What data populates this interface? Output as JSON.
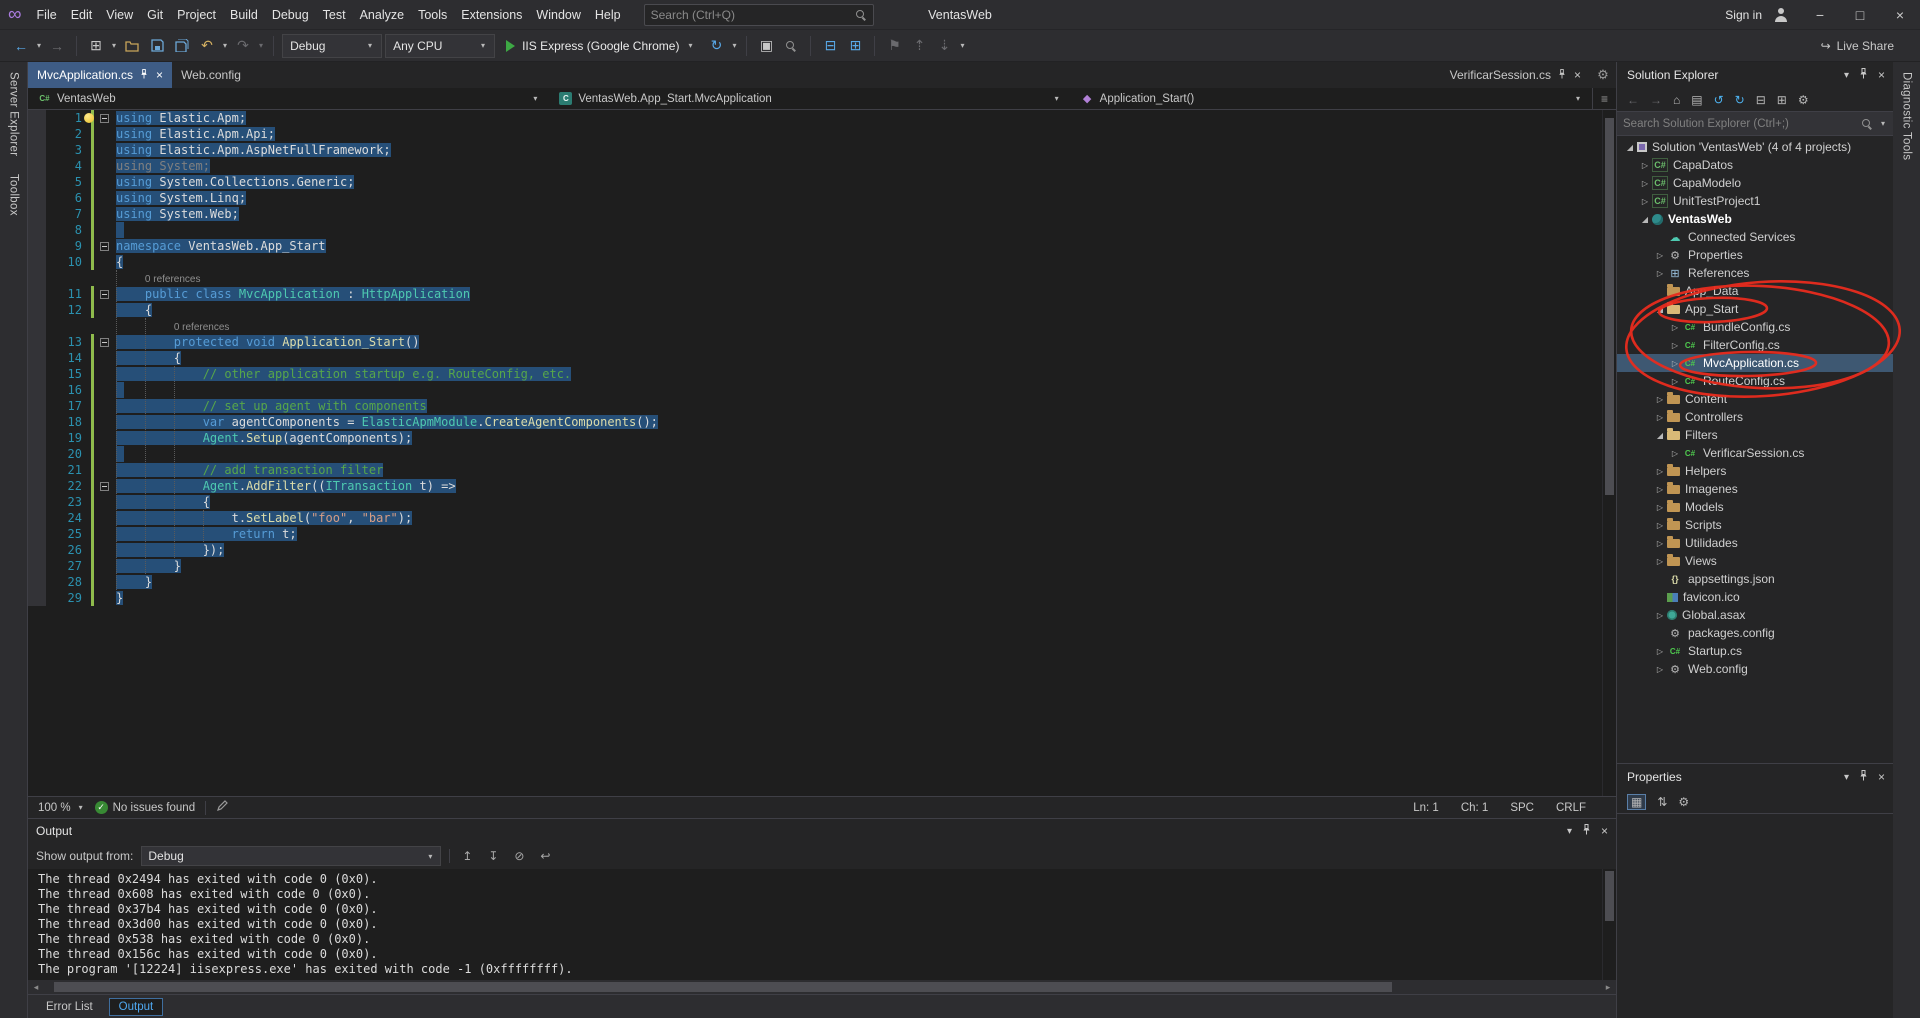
{
  "colors": {
    "accent": "#007ACC",
    "selection": "#264F78",
    "annotation_red": "#E82C1E"
  },
  "title_bar": {
    "menus": [
      "File",
      "Edit",
      "View",
      "Git",
      "Project",
      "Build",
      "Debug",
      "Test",
      "Analyze",
      "Tools",
      "Extensions",
      "Window",
      "Help"
    ],
    "search_placeholder": "Search (Ctrl+Q)",
    "window_title": "VentasWeb",
    "sign_in_label": "Sign in"
  },
  "toolbar": {
    "configuration": "Debug",
    "platform": "Any CPU",
    "run_target": "IIS Express (Google Chrome)",
    "live_share_label": "Live Share"
  },
  "left_strip": {
    "tabs": [
      "Server Explorer",
      "Toolbox"
    ]
  },
  "right_strip": {
    "tabs": [
      "Diagnostic Tools"
    ]
  },
  "document_tabs": {
    "left": [
      {
        "label": "MvcApplication.cs",
        "active": true
      },
      {
        "label": "Web.config",
        "active": false
      }
    ],
    "right": [
      {
        "label": "VerificarSession.cs",
        "active": false
      }
    ]
  },
  "breadcrumb": {
    "segments": [
      {
        "label": "VentasWeb",
        "icon": "csharp-project-icon"
      },
      {
        "label": "VentasWeb.App_Start.MvcApplication",
        "icon": "class-icon"
      },
      {
        "label": "Application_Start()",
        "icon": "method-icon"
      }
    ]
  },
  "editor": {
    "codelens_label": "0 references",
    "lines": [
      {
        "n": 1,
        "fold": true,
        "bulb": true,
        "sel": true,
        "segs": [
          [
            "k",
            "using"
          ],
          [
            "p",
            " Elastic.Apm;"
          ]
        ]
      },
      {
        "n": 2,
        "sel": true,
        "segs": [
          [
            "k",
            "using"
          ],
          [
            "p",
            " Elastic.Apm.Api;"
          ]
        ]
      },
      {
        "n": 3,
        "sel": true,
        "segs": [
          [
            "k",
            "using"
          ],
          [
            "p",
            " Elastic.Apm.AspNetFullFramework;"
          ]
        ]
      },
      {
        "n": 4,
        "sel": true,
        "segs": [
          [
            "d",
            "using System;"
          ]
        ]
      },
      {
        "n": 5,
        "sel": true,
        "segs": [
          [
            "k",
            "using"
          ],
          [
            "p",
            " System.Collections.Generic;"
          ]
        ]
      },
      {
        "n": 6,
        "sel": true,
        "segs": [
          [
            "k",
            "using"
          ],
          [
            "p",
            " System.Linq;"
          ]
        ]
      },
      {
        "n": 7,
        "sel": true,
        "segs": [
          [
            "k",
            "using"
          ],
          [
            "p",
            " System.Web;"
          ]
        ]
      },
      {
        "n": 8,
        "sel": true,
        "segs": []
      },
      {
        "n": 9,
        "fold": true,
        "sel": true,
        "segs": [
          [
            "k",
            "namespace"
          ],
          [
            "p",
            " VentasWeb.App_Start"
          ]
        ]
      },
      {
        "n": 10,
        "sel": true,
        "segs": [
          [
            "p",
            "{"
          ]
        ]
      },
      {
        "lens": true,
        "indent": 4
      },
      {
        "n": 11,
        "fold": true,
        "sel": true,
        "segs": [
          [
            "p",
            "    "
          ],
          [
            "k",
            "public"
          ],
          [
            "p",
            " "
          ],
          [
            "k",
            "class"
          ],
          [
            "p",
            " "
          ],
          [
            "t",
            "MvcApplication"
          ],
          [
            "p",
            " : "
          ],
          [
            "t",
            "HttpApplication"
          ]
        ]
      },
      {
        "n": 12,
        "sel": true,
        "segs": [
          [
            "p",
            "    {"
          ]
        ]
      },
      {
        "lens": true,
        "indent": 8
      },
      {
        "n": 13,
        "fold": true,
        "sel": true,
        "segs": [
          [
            "p",
            "        "
          ],
          [
            "k",
            "protected"
          ],
          [
            "p",
            " "
          ],
          [
            "k",
            "void"
          ],
          [
            "p",
            " "
          ],
          [
            "m",
            "Application_Start"
          ],
          [
            "p",
            "()"
          ]
        ]
      },
      {
        "n": 14,
        "sel": true,
        "segs": [
          [
            "p",
            "        {"
          ]
        ]
      },
      {
        "n": 15,
        "sel": true,
        "segs": [
          [
            "p",
            "            "
          ],
          [
            "c",
            "// other application startup e.g. RouteConfig, etc."
          ]
        ]
      },
      {
        "n": 16,
        "sel": true,
        "segs": []
      },
      {
        "n": 17,
        "sel": true,
        "segs": [
          [
            "p",
            "            "
          ],
          [
            "c",
            "// set up agent with components"
          ]
        ]
      },
      {
        "n": 18,
        "sel": true,
        "segs": [
          [
            "p",
            "            "
          ],
          [
            "k",
            "var"
          ],
          [
            "p",
            " agentComponents = "
          ],
          [
            "t",
            "ElasticApmModule"
          ],
          [
            "p",
            "."
          ],
          [
            "m",
            "CreateAgentComponents"
          ],
          [
            "p",
            "();"
          ]
        ]
      },
      {
        "n": 19,
        "sel": true,
        "segs": [
          [
            "p",
            "            "
          ],
          [
            "t",
            "Agent"
          ],
          [
            "p",
            "."
          ],
          [
            "m",
            "Setup"
          ],
          [
            "p",
            "(agentComponents);"
          ]
        ]
      },
      {
        "n": 20,
        "sel": true,
        "segs": []
      },
      {
        "n": 21,
        "sel": true,
        "segs": [
          [
            "p",
            "            "
          ],
          [
            "c",
            "// add transaction filter"
          ]
        ]
      },
      {
        "n": 22,
        "fold": true,
        "sel": true,
        "segs": [
          [
            "p",
            "            "
          ],
          [
            "t",
            "Agent"
          ],
          [
            "p",
            "."
          ],
          [
            "m",
            "AddFilter"
          ],
          [
            "p",
            "(("
          ],
          [
            "t",
            "ITransaction"
          ],
          [
            "p",
            " t) =>"
          ]
        ]
      },
      {
        "n": 23,
        "sel": true,
        "segs": [
          [
            "p",
            "            {"
          ]
        ]
      },
      {
        "n": 24,
        "sel": true,
        "segs": [
          [
            "p",
            "                t."
          ],
          [
            "m",
            "SetLabel"
          ],
          [
            "p",
            "("
          ],
          [
            "s",
            "\"foo\""
          ],
          [
            "p",
            ", "
          ],
          [
            "s",
            "\"bar\""
          ],
          [
            "p",
            ");"
          ]
        ]
      },
      {
        "n": 25,
        "sel": true,
        "segs": [
          [
            "p",
            "                "
          ],
          [
            "k",
            "return"
          ],
          [
            "p",
            " t;"
          ]
        ]
      },
      {
        "n": 26,
        "sel": true,
        "segs": [
          [
            "p",
            "            });"
          ]
        ]
      },
      {
        "n": 27,
        "sel": true,
        "segs": [
          [
            "p",
            "        }"
          ]
        ]
      },
      {
        "n": 28,
        "sel": true,
        "segs": [
          [
            "p",
            "    }"
          ]
        ]
      },
      {
        "n": 29,
        "sel": true,
        "segs": [
          [
            "p",
            "}"
          ]
        ]
      }
    ]
  },
  "editor_status": {
    "zoom": "100 %",
    "health": "No issues found",
    "line": "Ln: 1",
    "column": "Ch: 1",
    "spaces": "SPC",
    "line_ending": "CRLF"
  },
  "output_panel": {
    "title": "Output",
    "show_output_from_label": "Show output from:",
    "source": "Debug",
    "log_lines": [
      "The thread 0x2494 has exited with code 0 (0x0).",
      "The thread 0x608 has exited with code 0 (0x0).",
      "The thread 0x37b4 has exited with code 0 (0x0).",
      "The thread 0x3d00 has exited with code 0 (0x0).",
      "The thread 0x538 has exited with code 0 (0x0).",
      "The thread 0x156c has exited with code 0 (0x0).",
      "The program '[12224] iisexpress.exe' has exited with code -1 (0xffffffff)."
    ]
  },
  "bottom_tabs": [
    {
      "label": "Error List",
      "active": false
    },
    {
      "label": "Output",
      "active": true
    }
  ],
  "solution_explorer": {
    "title": "Solution Explorer",
    "search_placeholder": "Search Solution Explorer (Ctrl+;)",
    "tree": [
      {
        "label": "Solution 'VentasWeb' (4 of 4 projects)",
        "depth": 0,
        "arrow": "expanded",
        "icon": "solution"
      },
      {
        "label": "CapaDatos",
        "depth": 1,
        "arrow": "collapsed",
        "icon": "csproj"
      },
      {
        "label": "CapaModelo",
        "depth": 1,
        "arrow": "collapsed",
        "icon": "csproj"
      },
      {
        "label": "UnitTestProject1",
        "depth": 1,
        "arrow": "collapsed",
        "icon": "csproj"
      },
      {
        "label": "VentasWeb",
        "depth": 1,
        "arrow": "expanded",
        "icon": "webproj",
        "bold": true
      },
      {
        "label": "Connected Services",
        "depth": 2,
        "arrow": "none",
        "icon": "cloud"
      },
      {
        "label": "Properties",
        "depth": 2,
        "arrow": "collapsed",
        "icon": "props"
      },
      {
        "label": "References",
        "depth": 2,
        "arrow": "collapsed",
        "icon": "refs"
      },
      {
        "label": "App_Data",
        "depth": 2,
        "arrow": "none",
        "icon": "folder"
      },
      {
        "label": "App_Start",
        "depth": 2,
        "arrow": "expanded",
        "icon": "folder-open"
      },
      {
        "label": "BundleConfig.cs",
        "depth": 3,
        "arrow": "collapsed",
        "icon": "cs"
      },
      {
        "label": "FilterConfig.cs",
        "depth": 3,
        "arrow": "collapsed",
        "icon": "cs"
      },
      {
        "label": "MvcApplication.cs",
        "depth": 3,
        "arrow": "collapsed",
        "icon": "cs",
        "selected": true
      },
      {
        "label": "RouteConfig.cs",
        "depth": 3,
        "arrow": "collapsed",
        "icon": "cs"
      },
      {
        "label": "Content",
        "depth": 2,
        "arrow": "collapsed",
        "icon": "folder"
      },
      {
        "label": "Controllers",
        "depth": 2,
        "arrow": "collapsed",
        "icon": "folder"
      },
      {
        "label": "Filters",
        "depth": 2,
        "arrow": "expanded",
        "icon": "folder-open"
      },
      {
        "label": "VerificarSession.cs",
        "depth": 3,
        "arrow": "collapsed",
        "icon": "cs"
      },
      {
        "label": "Helpers",
        "depth": 2,
        "arrow": "collapsed",
        "icon": "folder"
      },
      {
        "label": "Imagenes",
        "depth": 2,
        "arrow": "collapsed",
        "icon": "folder"
      },
      {
        "label": "Models",
        "depth": 2,
        "arrow": "collapsed",
        "icon": "folder"
      },
      {
        "label": "Scripts",
        "depth": 2,
        "arrow": "collapsed",
        "icon": "folder"
      },
      {
        "label": "Utilidades",
        "depth": 2,
        "arrow": "collapsed",
        "icon": "folder"
      },
      {
        "label": "Views",
        "depth": 2,
        "arrow": "collapsed",
        "icon": "folder"
      },
      {
        "label": "appsettings.json",
        "depth": 2,
        "arrow": "none",
        "icon": "json"
      },
      {
        "label": "favicon.ico",
        "depth": 2,
        "arrow": "none",
        "icon": "image"
      },
      {
        "label": "Global.asax",
        "depth": 2,
        "arrow": "collapsed",
        "icon": "globe"
      },
      {
        "label": "packages.config",
        "depth": 2,
        "arrow": "none",
        "icon": "config"
      },
      {
        "label": "Startup.cs",
        "depth": 2,
        "arrow": "collapsed",
        "icon": "cs"
      },
      {
        "label": "Web.config",
        "depth": 2,
        "arrow": "collapsed",
        "icon": "config"
      }
    ]
  },
  "properties_panel": {
    "title": "Properties"
  }
}
